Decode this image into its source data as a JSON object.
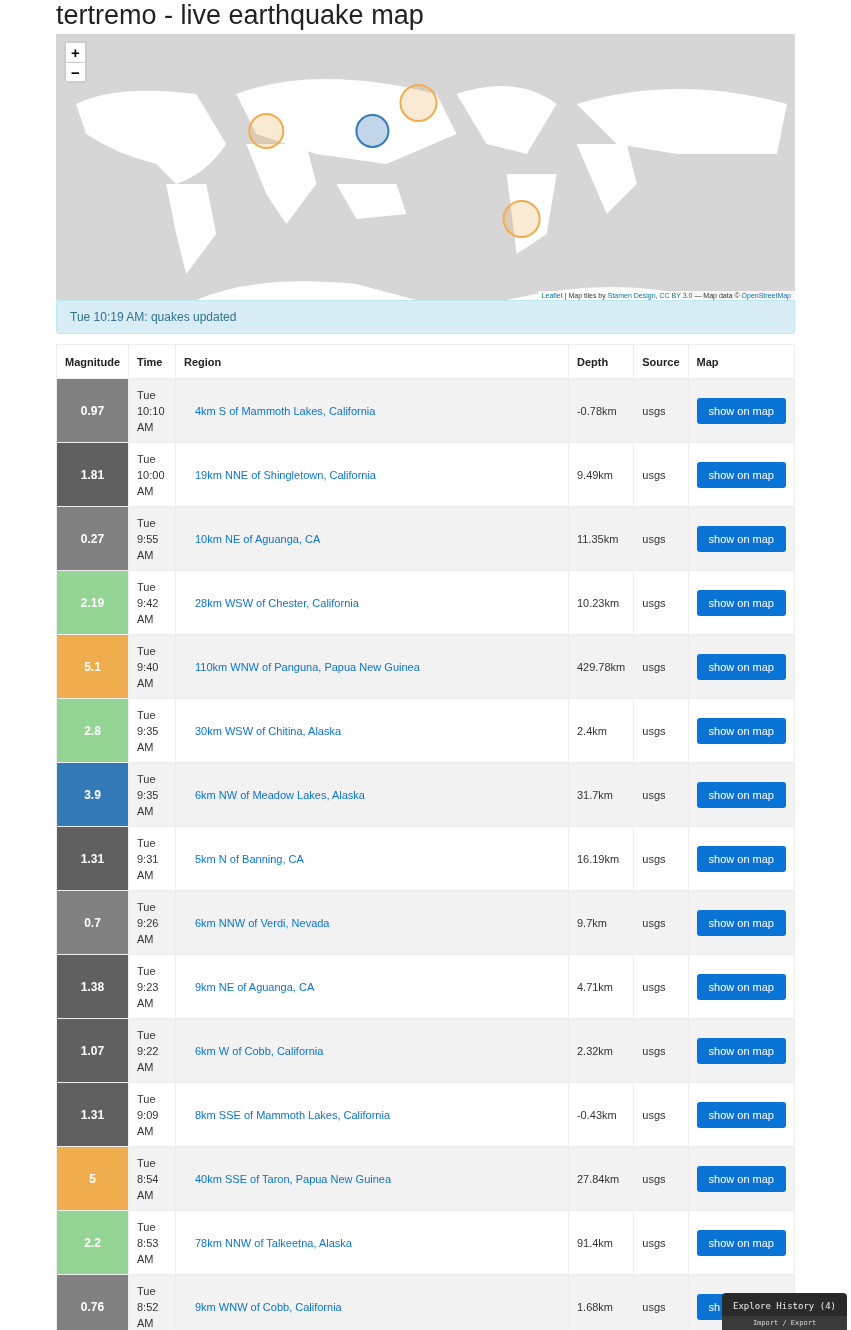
{
  "title": "tertremo - live earthquake map",
  "map": {
    "zoom_in": "+",
    "zoom_out": "−",
    "attribution": {
      "leaflet": "Leaflet",
      "tiles_text": "| Map tiles by",
      "stamen": "Stamen Design",
      "comma": ",",
      "license": "CC BY 3.0",
      "data_text": "— Map data ©",
      "osm": "OpenStreetMap"
    }
  },
  "alert": "Tue 10:19 AM: quakes updated",
  "table": {
    "columns": [
      "Magnitude",
      "Time",
      "Region",
      "Depth",
      "Source",
      "Map"
    ],
    "rows": [
      {
        "magnitude": "0.97",
        "color": "#808080",
        "time": "Tue 10:10 AM",
        "region": "4km S of Mammoth Lakes, California",
        "depth": "-0.78km",
        "source": "usgs",
        "action": "show on map"
      },
      {
        "magnitude": "1.81",
        "color": "#606060",
        "time": "Tue 10:00 AM",
        "region": "19km NNE of Shingletown, California",
        "depth": "9.49km",
        "source": "usgs",
        "action": "show on map"
      },
      {
        "magnitude": "0.27",
        "color": "#808080",
        "time": "Tue 9:55 AM",
        "region": "10km NE of Aguanga, CA",
        "depth": "11.35km",
        "source": "usgs",
        "action": "show on map"
      },
      {
        "magnitude": "2.19",
        "color": "#94d494",
        "time": "Tue 9:42 AM",
        "region": "28km WSW of Chester, California",
        "depth": "10.23km",
        "source": "usgs",
        "action": "show on map"
      },
      {
        "magnitude": "5.1",
        "color": "#f0ad4e",
        "time": "Tue 9:40 AM",
        "region": "110km WNW of Panguna, Papua New Guinea",
        "depth": "429.78km",
        "source": "usgs",
        "action": "show on map"
      },
      {
        "magnitude": "2.8",
        "color": "#94d494",
        "time": "Tue 9:35 AM",
        "region": "30km WSW of Chitina, Alaska",
        "depth": "2.4km",
        "source": "usgs",
        "action": "show on map"
      },
      {
        "magnitude": "3.9",
        "color": "#337ab7",
        "time": "Tue 9:35 AM",
        "region": "6km NW of Meadow Lakes, Alaska",
        "depth": "31.7km",
        "source": "usgs",
        "action": "show on map"
      },
      {
        "magnitude": "1.31",
        "color": "#606060",
        "time": "Tue 9:31 AM",
        "region": "5km N of Banning, CA",
        "depth": "16.19km",
        "source": "usgs",
        "action": "show on map"
      },
      {
        "magnitude": "0.7",
        "color": "#808080",
        "time": "Tue 9:26 AM",
        "region": "6km NNW of Verdi, Nevada",
        "depth": "9.7km",
        "source": "usgs",
        "action": "show on map"
      },
      {
        "magnitude": "1.38",
        "color": "#606060",
        "time": "Tue 9:23 AM",
        "region": "9km NE of Aguanga, CA",
        "depth": "4.71km",
        "source": "usgs",
        "action": "show on map"
      },
      {
        "magnitude": "1.07",
        "color": "#606060",
        "time": "Tue 9:22 AM",
        "region": "6km W of Cobb, California",
        "depth": "2.32km",
        "source": "usgs",
        "action": "show on map"
      },
      {
        "magnitude": "1.31",
        "color": "#606060",
        "time": "Tue 9:09 AM",
        "region": "8km SSE of Mammoth Lakes, California",
        "depth": "-0.43km",
        "source": "usgs",
        "action": "show on map"
      },
      {
        "magnitude": "5",
        "color": "#f0ad4e",
        "time": "Tue 8:54 AM",
        "region": "40km SSE of Taron, Papua New Guinea",
        "depth": "27.84km",
        "source": "usgs",
        "action": "show on map"
      },
      {
        "magnitude": "2.2",
        "color": "#94d494",
        "time": "Tue 8:53 AM",
        "region": "78km NNW of Talkeetna, Alaska",
        "depth": "91.4km",
        "source": "usgs",
        "action": "show on map"
      },
      {
        "magnitude": "0.76",
        "color": "#808080",
        "time": "Tue 8:52 AM",
        "region": "9km WNW of Cobb, California",
        "depth": "1.68km",
        "source": "usgs",
        "action": "sh"
      }
    ]
  },
  "history_panel": {
    "title": "Explore History (4)",
    "action": "Import / Export"
  }
}
